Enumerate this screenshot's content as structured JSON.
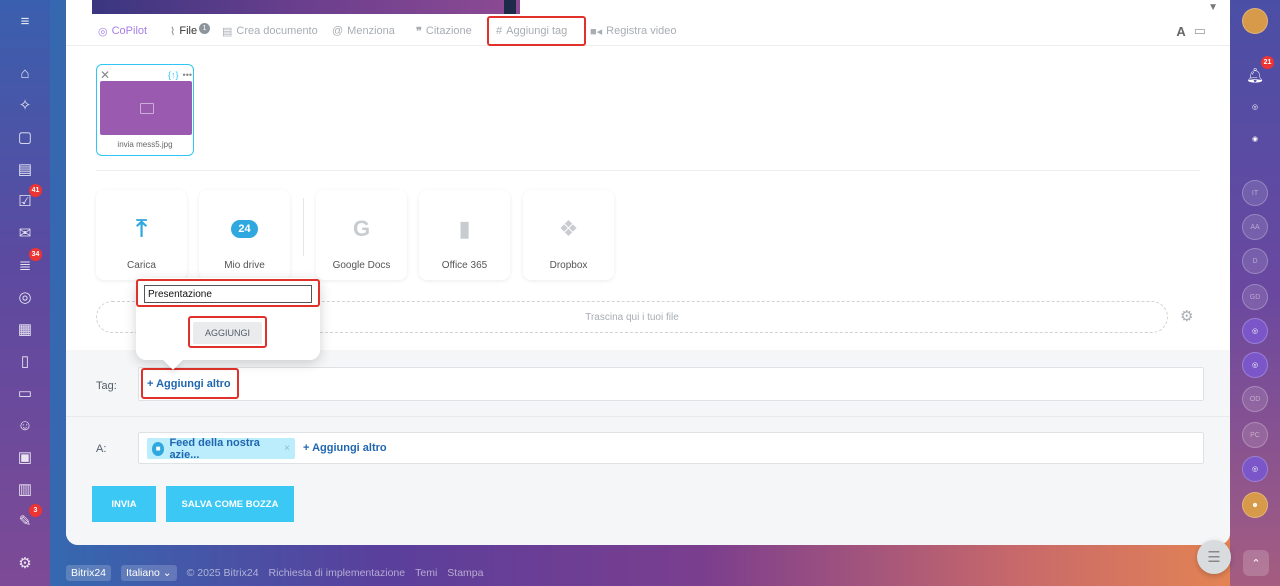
{
  "toolbar": {
    "copilot": "CoPilot",
    "file": "File",
    "file_count": "1",
    "create_document": "Crea documento",
    "mention": "Menziona",
    "quote": "Citazione",
    "add_tag": "Aggiungi tag",
    "record_video": "Registra video",
    "font_toggle": "A"
  },
  "attachment": {
    "filename": "invia mess5.jpg"
  },
  "upload_sources": [
    {
      "label": "Carica",
      "icon": "upload-icon"
    },
    {
      "label": "Mio drive",
      "icon": "cloud-24-icon",
      "badge": "24"
    },
    {
      "label": "Google Docs",
      "icon": "google-icon"
    },
    {
      "label": "Office 365",
      "icon": "office-icon"
    },
    {
      "label": "Dropbox",
      "icon": "dropbox-icon"
    }
  ],
  "dropzone": {
    "text": "Trascina qui i tuoi file"
  },
  "tag_popup": {
    "input_value": "Presentazione",
    "add_button": "AGGIUNGI"
  },
  "tag_row": {
    "label": "Tag:",
    "add_more": "+ Aggiungi altro"
  },
  "to_row": {
    "label": "A:",
    "recipient": "Feed della nostra azie...",
    "remove": "×",
    "add_more": "+ Aggiungi altro"
  },
  "actions": {
    "send": "INVIA",
    "save_draft": "SALVA COME BOZZA"
  },
  "footer": {
    "brand": "Bitrix24",
    "language": "Italiano",
    "copyright": "© 2025 Bitrix24",
    "implementation": "Richiesta di implementazione",
    "themes": "Temi",
    "print": "Stampa"
  },
  "left_badges": {
    "tasks": "41",
    "feed": "34",
    "approvals": "3"
  },
  "right_bar": {
    "notifications": "21",
    "avatars": [
      "IT",
      "AA",
      "D",
      "GD",
      "OD",
      "PC"
    ]
  },
  "colors": {
    "accent": "#3bc8f5",
    "highlight": "#e0312b",
    "link": "#2067b0"
  }
}
